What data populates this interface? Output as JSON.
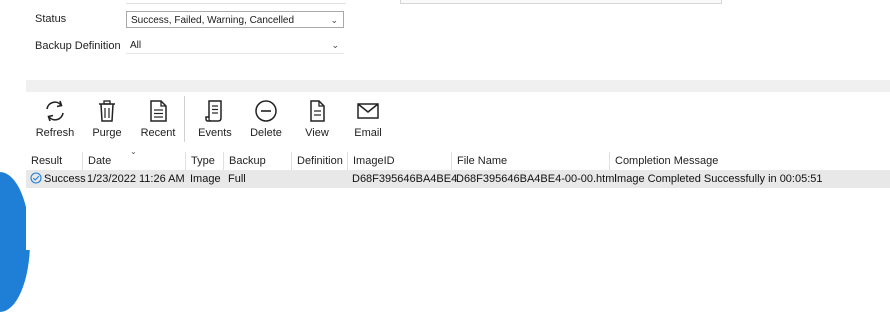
{
  "filters": {
    "status_label": "Status",
    "status_value": "Success, Failed, Warning, Cancelled",
    "backup_def_label": "Backup Definition",
    "backup_def_value": "All"
  },
  "toolbar": {
    "refresh": "Refresh",
    "purge": "Purge",
    "recent": "Recent",
    "events": "Events",
    "delete": "Delete",
    "view": "View",
    "email": "Email"
  },
  "table": {
    "columns": [
      "Result",
      "Date",
      "Type",
      "Backup Type",
      "Definition",
      "ImageID",
      "File Name",
      "Completion Message"
    ],
    "rows": [
      {
        "result": "Success",
        "date": "1/23/2022 11:26 AM",
        "type": "Image",
        "backup_type": "Full",
        "definition": "",
        "image_id": "D68F395646BA4BE4",
        "file_name": "D68F395646BA4BE4-00-00.html",
        "completion_message": "Image Completed Successfully in 00:05:51"
      }
    ]
  },
  "colors": {
    "accent": "#1f7fd6",
    "row_bg": "#e8e8e8",
    "band": "#f0f0f0"
  }
}
